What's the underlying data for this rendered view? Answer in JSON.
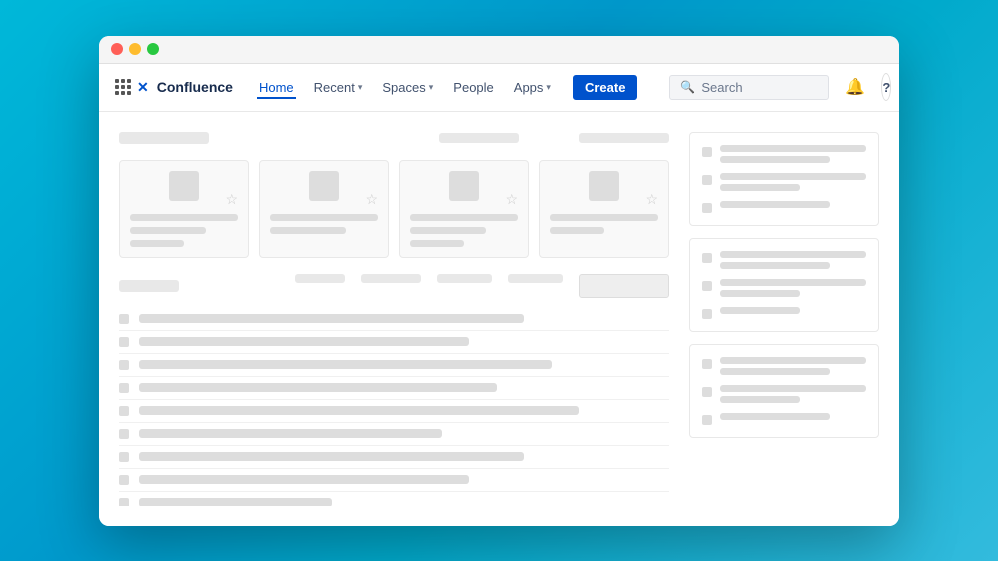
{
  "window": {
    "title": "Confluence"
  },
  "titlebar": {
    "close_label": "close",
    "minimize_label": "minimize",
    "maximize_label": "maximize"
  },
  "navbar": {
    "grid_icon_label": "apps-grid",
    "logo_x": "✕",
    "logo_text": "Confluence",
    "home_label": "Home",
    "recent_label": "Recent",
    "spaces_label": "Spaces",
    "people_label": "People",
    "apps_label": "Apps",
    "create_label": "Create",
    "search_placeholder": "Search",
    "notification_icon": "🔔",
    "help_icon": "?",
    "caret": "▾"
  },
  "main": {
    "section1": {
      "title_width": 80
    },
    "cards": [
      {
        "id": 1
      },
      {
        "id": 2
      },
      {
        "id": 3
      },
      {
        "id": 4
      }
    ],
    "list_section": {
      "tabs": [
        "tab1",
        "tab2",
        "tab3",
        "tab4"
      ],
      "items": [
        {
          "id": 1,
          "width": "w70"
        },
        {
          "id": 2,
          "width": "w60"
        },
        {
          "id": 3,
          "width": "w75"
        },
        {
          "id": 4,
          "width": "w65"
        },
        {
          "id": 5,
          "width": "w80"
        },
        {
          "id": 6,
          "width": "w55"
        },
        {
          "id": 7,
          "width": "w70"
        },
        {
          "id": 8,
          "width": "w60"
        },
        {
          "id": 9,
          "width": "w50"
        }
      ]
    }
  },
  "right_panel": {
    "cards": [
      {
        "rows": [
          {
            "lines": [
              "full",
              "med"
            ]
          },
          {
            "lines": [
              "full",
              "short"
            ]
          },
          {
            "lines": [
              "med"
            ]
          }
        ]
      },
      {
        "rows": [
          {
            "lines": [
              "full",
              "med"
            ]
          },
          {
            "lines": [
              "full",
              "short"
            ]
          },
          {
            "lines": [
              "med"
            ]
          }
        ]
      },
      {
        "rows": [
          {
            "lines": [
              "full",
              "med"
            ]
          },
          {
            "lines": [
              "full",
              "short"
            ]
          },
          {
            "lines": [
              "med"
            ]
          }
        ]
      }
    ]
  }
}
